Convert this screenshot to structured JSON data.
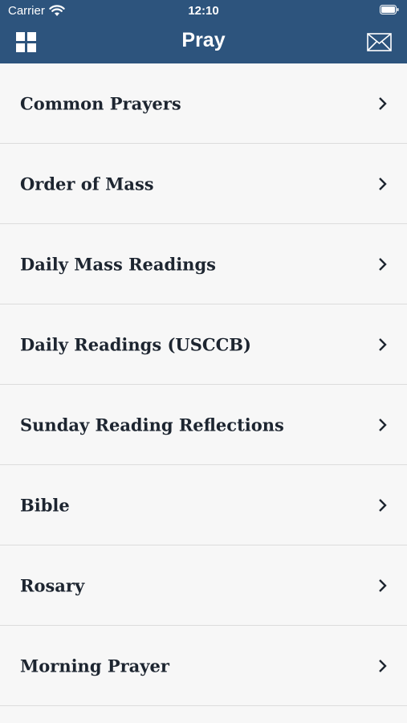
{
  "status_bar": {
    "carrier": "Carrier",
    "time": "12:10"
  },
  "navbar": {
    "title": "Pray",
    "left_icon": "grid-icon",
    "right_icon": "mail-icon",
    "background_color": "#2d547d"
  },
  "list": {
    "items": [
      {
        "label": "Common Prayers"
      },
      {
        "label": "Order of Mass"
      },
      {
        "label": "Daily Mass Readings"
      },
      {
        "label": "Daily Readings (USCCB)"
      },
      {
        "label": "Sunday Reading Reflections"
      },
      {
        "label": "Bible"
      },
      {
        "label": "Rosary"
      },
      {
        "label": "Morning Prayer"
      }
    ]
  }
}
